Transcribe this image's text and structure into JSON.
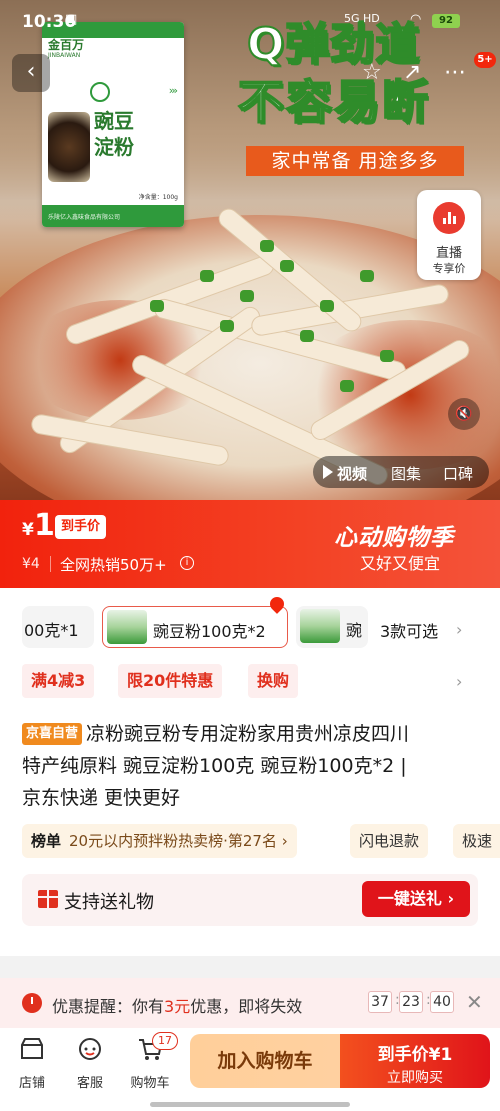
{
  "status_bar": {
    "time": "10:36",
    "signal": "5G HD",
    "battery": "92"
  },
  "nav": {
    "back_icon": "chevron-left-icon",
    "badge": "5+"
  },
  "hero": {
    "package_brand": "金百万",
    "package_brand_en": "JINBAIWAN",
    "package_title": "豌豆淀粉",
    "package_net": "净含量：100g",
    "package_bottom": "乐陵亿入鑫味食品有限公司",
    "slogan_line1": "Q弹劲道",
    "slogan_line2": "不容易断",
    "slogan_bar": "家中常备 用途多多",
    "live_label1": "直播",
    "live_label2": "专享价",
    "media_tabs": [
      "视频",
      "图集",
      "口碑"
    ]
  },
  "price_banner": {
    "currency": "¥",
    "price": "1",
    "price_tag": "到手价",
    "original_price": "¥4",
    "sales": "全网热销50万+",
    "event_title": "心动购物季",
    "event_sub": "又好又便宜"
  },
  "variants": {
    "items": [
      {
        "label": "00克*1",
        "selected": false
      },
      {
        "label": "豌豆粉100克*2",
        "selected": true
      },
      {
        "label": "豌",
        "selected": false
      }
    ],
    "count_label": "3款可选"
  },
  "promos": [
    "满4减3",
    "限20件特惠",
    "换购"
  ],
  "title": {
    "brand_tag": "京喜自营",
    "line1": "凉粉豌豆粉专用淀粉家用贵州凉皮四川",
    "line2": "特产纯原料 豌豆淀粉100克 豌豆粉100克*2 |",
    "line3": "京东快递 更快更好"
  },
  "rank": {
    "label": "榜单",
    "text": "20元以内预拌粉热卖榜·第27名 ›",
    "refund": "闪电退款",
    "speed": "极速"
  },
  "gift": {
    "label": "支持送礼物",
    "button": "一键送礼 ›"
  },
  "reminder": {
    "prefix": "优惠提醒：你有",
    "amount": "3元",
    "suffix": "优惠，即将失效",
    "countdown": [
      "37",
      "23",
      "40"
    ]
  },
  "bottom_bar": {
    "items": [
      {
        "label": "店铺",
        "icon": "store-icon"
      },
      {
        "label": "客服",
        "icon": "customer-service-icon"
      },
      {
        "label": "购物车",
        "icon": "cart-icon",
        "badge": "17"
      }
    ],
    "add_cart": "加入购物车",
    "buy_line1": "到手价¥1",
    "buy_line2": "立即购买"
  }
}
